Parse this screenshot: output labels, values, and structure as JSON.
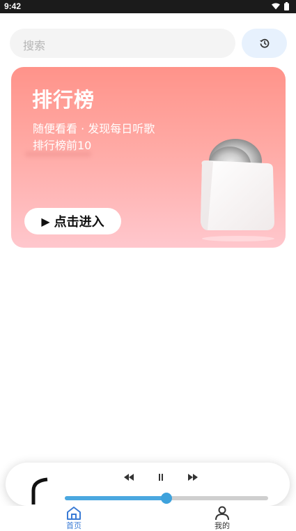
{
  "status_bar": {
    "time": "9:42",
    "icons": [
      "wifi-icon",
      "battery-icon"
    ]
  },
  "search": {
    "placeholder": "搜索",
    "history_icon": "history-icon"
  },
  "rank_card": {
    "title": "排行榜",
    "subtitle": "随便看看 · 发现每日听歌",
    "description": "排行榜前10",
    "button_label": "点击进入",
    "button_icon": "play-icon",
    "gradient": [
      "#ff938a",
      "#ffc7cd"
    ]
  },
  "player": {
    "controls": [
      "rewind-icon",
      "pause-icon",
      "fast-forward-icon"
    ],
    "progress": 0.5,
    "accent": "#4aa8e0"
  },
  "nav": {
    "items": [
      {
        "label": "首页",
        "icon": "home-icon",
        "active": true
      },
      {
        "label": "我的",
        "icon": "person-icon",
        "active": false
      }
    ],
    "active_color": "#3a7bd5"
  }
}
